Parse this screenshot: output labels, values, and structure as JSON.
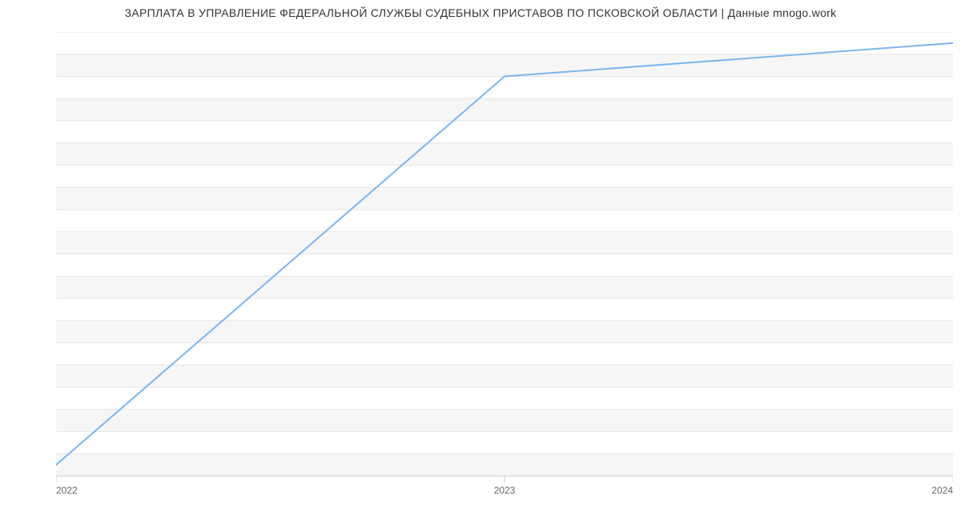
{
  "chart_data": {
    "type": "line",
    "title": "ЗАРПЛАТА В УПРАВЛЕНИЕ ФЕДЕРАЛЬНОЙ СЛУЖБЫ СУДЕБНЫХ ПРИСТАВОВ ПО ПСКОВСКОЙ ОБЛАСТИ | Данные mnogo.work",
    "x": [
      2022,
      2023,
      2024
    ],
    "values": [
      17000,
      52000,
      55000
    ],
    "xlabel": "",
    "ylabel": "",
    "xlim": [
      2022,
      2024
    ],
    "ylim": [
      16000,
      56000
    ],
    "x_ticks": [
      2022,
      2023,
      2024
    ],
    "y_ticks": [
      16000,
      18000,
      20000,
      22000,
      24000,
      26000,
      28000,
      30000,
      32000,
      34000,
      36000,
      38000,
      40000,
      42000,
      44000,
      46000,
      48000,
      50000,
      52000,
      54000,
      56000
    ],
    "colors": {
      "line": "#7cb5ec",
      "grid_band": "#f6f6f6"
    }
  }
}
